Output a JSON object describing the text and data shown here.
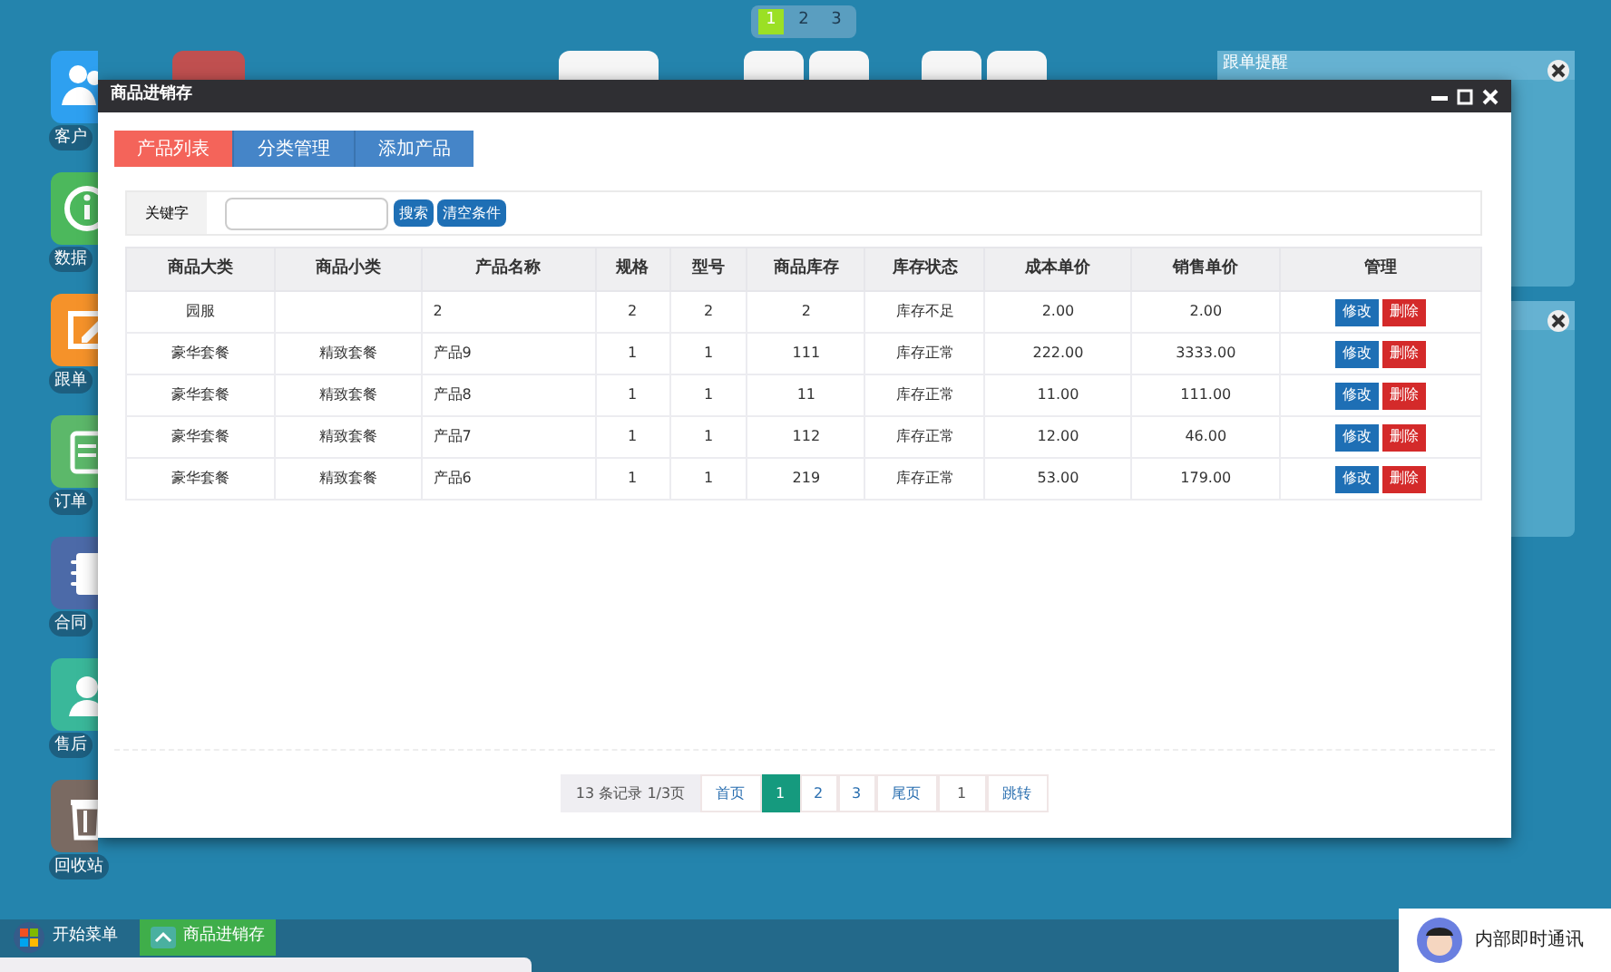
{
  "desktop_switcher": [
    {
      "label": "1",
      "selected": true
    },
    {
      "label": "2",
      "selected": false
    },
    {
      "label": "3",
      "selected": false
    }
  ],
  "desktop_icons": [
    {
      "label": "客户",
      "kind": "users",
      "color": "#2ea0f0"
    },
    {
      "label": "数据",
      "kind": "info",
      "color": "#4cb85c"
    },
    {
      "label": "跟单",
      "kind": "edit",
      "color": "#f5922a"
    },
    {
      "label": "订单",
      "kind": "clipboard",
      "color": "#5cb86a"
    },
    {
      "label": "合同",
      "kind": "notebook",
      "color": "#4c6aa8"
    },
    {
      "label": "售后",
      "kind": "agent",
      "color": "#3ab89a"
    },
    {
      "label": "回收站",
      "kind": "trash",
      "color": "#7a6a62"
    }
  ],
  "widgets": [
    {
      "title": "跟单提醒",
      "kind": "titled"
    },
    {
      "kind": "plain"
    }
  ],
  "window": {
    "title": "商品进销存",
    "tabs": [
      {
        "label": "产品列表",
        "selected": true
      },
      {
        "label": "分类管理",
        "selected": false
      },
      {
        "label": "添加产品",
        "selected": false
      }
    ],
    "search": {
      "label": "关键字",
      "buttons": [
        "搜索",
        "清空条件"
      ]
    },
    "table": {
      "columns": [
        "商品大类",
        "商品小类",
        "产品名称",
        "规格",
        "型号",
        "商品库存",
        "库存状态",
        "成本单价",
        "销售单价",
        "管理"
      ],
      "rows": [
        {
          "cells": [
            "园服",
            "",
            "2",
            "2",
            "2",
            "2",
            "库存不足",
            "2.00",
            "2.00"
          ],
          "actions": [
            "修改",
            "删除"
          ]
        },
        {
          "cells": [
            "豪华套餐",
            "精致套餐",
            "产品9",
            "1",
            "1",
            "111",
            "库存正常",
            "222.00",
            "3333.00"
          ],
          "actions": [
            "修改",
            "删除"
          ]
        },
        {
          "cells": [
            "豪华套餐",
            "精致套餐",
            "产品8",
            "1",
            "1",
            "11",
            "库存正常",
            "11.00",
            "111.00"
          ],
          "actions": [
            "修改",
            "删除"
          ]
        },
        {
          "cells": [
            "豪华套餐",
            "精致套餐",
            "产品7",
            "1",
            "1",
            "112",
            "库存正常",
            "12.00",
            "46.00"
          ],
          "actions": [
            "修改",
            "删除"
          ]
        },
        {
          "cells": [
            "豪华套餐",
            "精致套餐",
            "产品6",
            "1",
            "1",
            "219",
            "库存正常",
            "53.00",
            "179.00"
          ],
          "actions": [
            "修改",
            "删除"
          ]
        }
      ]
    },
    "pagination": {
      "summary": "13 条记录 1/3页",
      "first": "首页",
      "pages": [
        {
          "label": "1",
          "selected": true
        },
        {
          "label": "2",
          "selected": false
        },
        {
          "label": "3",
          "selected": false
        }
      ],
      "last": "尾页",
      "jump_value": "1",
      "jump": "跳转"
    }
  },
  "taskbar": {
    "start": "开始菜单",
    "tasks": [
      "商品进销存"
    ]
  },
  "chat_button": "内部即时通讯"
}
